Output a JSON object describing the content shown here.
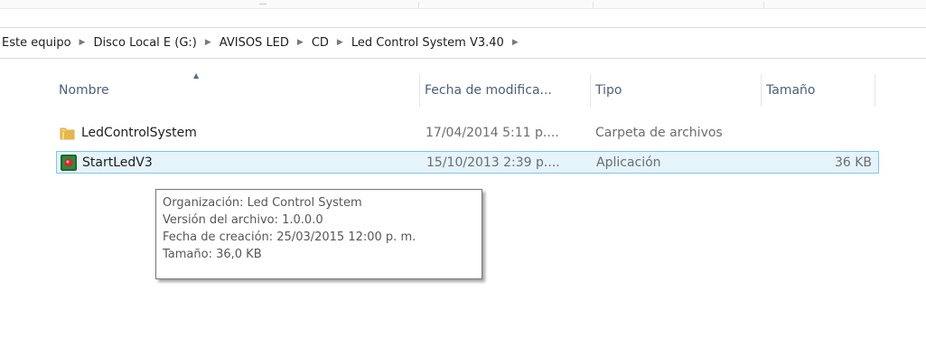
{
  "breadcrumb": {
    "items": [
      "Este equipo",
      "Disco Local E (G:)",
      "AVISOS LED",
      "CD",
      "Led Control System V3.40"
    ],
    "separator": "▶"
  },
  "columns": {
    "name": "Nombre",
    "date": "Fecha de modifica...",
    "type": "Tipo",
    "size": "Tamaño"
  },
  "files": [
    {
      "name": "LedControlSystem",
      "date": "17/04/2014 5:11 p....",
      "type": "Carpeta de archivos",
      "size": "",
      "icon": "folder-icon"
    },
    {
      "name": "StartLedV3",
      "date": "15/10/2013 2:39 p....",
      "type": "Aplicación",
      "size": "36 KB",
      "icon": "application-icon"
    }
  ],
  "tooltip": {
    "lines": [
      "Organización: Led Control System",
      "Versión del archivo: 1.0.0.0",
      "Fecha de creación: 25/03/2015 12:00 p. m.",
      "Tamaño: 36,0 KB"
    ]
  },
  "colors": {
    "header_text": "#4c607a",
    "selection_bg": "#e5f3fb",
    "selection_border": "#7ec5ed",
    "folder": "#e8b54a"
  }
}
